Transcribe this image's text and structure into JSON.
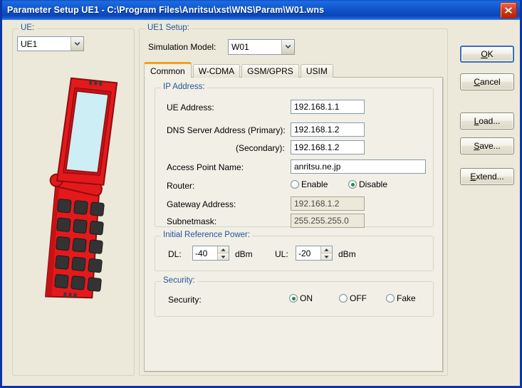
{
  "window": {
    "title": "Parameter Setup UE1 - C:\\Program Files\\Anritsu\\xst\\WNS\\Param\\W01.wns",
    "close_icon": "close-icon"
  },
  "colors": {
    "titlebar": "#1258CE",
    "dialog_bg": "#ECE9DA",
    "tab_page_bg": "#F1EFE6",
    "group_label": "#26559B",
    "tab_selected_accent": "#F0A11E",
    "radio_dot": "#2C8C3C",
    "phone_body": "#E4191C",
    "phone_screen": "#CCEEF4",
    "phone_key": "#333333"
  },
  "ue_panel": {
    "group_label": "UE:",
    "combo": {
      "value": "UE1",
      "arrow_icon": "chevron-down-icon"
    },
    "illustration": "red-flip-phone-illustration"
  },
  "setup_panel": {
    "group_label": "UE1 Setup:",
    "simulation_model": {
      "label": "Simulation Model:",
      "value": "W01",
      "arrow_icon": "chevron-down-icon"
    },
    "tabs": [
      {
        "label": "Common",
        "selected": true
      },
      {
        "label": "W-CDMA",
        "selected": false
      },
      {
        "label": "GSM/GPRS",
        "selected": false
      },
      {
        "label": "USIM",
        "selected": false
      }
    ],
    "ip_address": {
      "group_label": "IP Address:",
      "fields": [
        {
          "label": "UE Address:",
          "value": "192.168.1.1",
          "enabled": true
        },
        {
          "label": "DNS Server Address (Primary):",
          "value": "192.168.1.2",
          "enabled": true
        },
        {
          "label": "(Secondary):",
          "value": "192.168.1.2",
          "enabled": true
        },
        {
          "label": "Access Point Name:",
          "value": "anritsu.ne.jp",
          "enabled": true
        },
        {
          "label": "Gateway Address:",
          "value": "192.168.1.2",
          "enabled": false
        },
        {
          "label": "Subnetmask:",
          "value": "255.255.255.0",
          "enabled": false
        }
      ],
      "router": {
        "label": "Router:",
        "options": [
          {
            "label": "Enable",
            "selected": false
          },
          {
            "label": "Disable",
            "selected": true
          }
        ]
      }
    },
    "initial_reference_power": {
      "group_label": "Initial Reference Power:",
      "dl": {
        "label": "DL:",
        "value": "-40",
        "unit": "dBm"
      },
      "ul": {
        "label": "UL:",
        "value": "-20",
        "unit": "dBm"
      }
    },
    "security": {
      "group_label": "Security:",
      "label": "Security:",
      "options": [
        {
          "label": "ON",
          "selected": true
        },
        {
          "label": "OFF",
          "selected": false
        },
        {
          "label": "Fake",
          "selected": false
        }
      ]
    }
  },
  "buttons": {
    "ok": {
      "pre": "",
      "accel": "O",
      "post": "K",
      "default": true
    },
    "cancel": {
      "pre": "",
      "accel": "C",
      "post": "ancel",
      "default": false
    },
    "load": {
      "pre": "",
      "accel": "L",
      "post": "oad...",
      "default": false
    },
    "save": {
      "pre": "",
      "accel": "S",
      "post": "ave...",
      "default": false
    },
    "extend": {
      "pre": "",
      "accel": "E",
      "post": "xtend...",
      "default": false
    }
  }
}
